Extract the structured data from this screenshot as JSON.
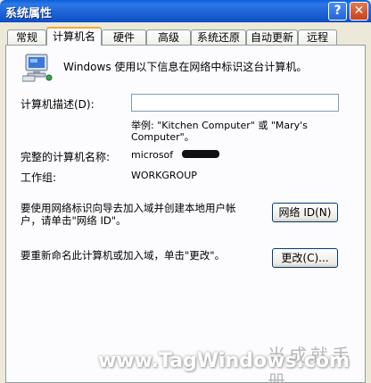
{
  "window": {
    "title": "系统属性",
    "help_label": "?",
    "close_label": "✕"
  },
  "tabs": [
    {
      "label": "常规"
    },
    {
      "label": "计算机名"
    },
    {
      "label": "硬件"
    },
    {
      "label": "高级"
    },
    {
      "label": "系统还原"
    },
    {
      "label": "自动更新"
    },
    {
      "label": "远程"
    }
  ],
  "panel": {
    "intro": "Windows 使用以下信息在网络中标识这台计算机。",
    "description_label": "计算机描述(D):",
    "description_value": "",
    "example_line1": "举例: \"Kitchen Computer\" 或 \"Mary's",
    "example_line2": "Computer\"。",
    "fullname_label": "完整的计算机名称:",
    "fullname_value": "microsof",
    "workgroup_label": "工作组:",
    "workgroup_value": "WORKGROUP",
    "network_text_line1": "要使用网络标识向导去加入域并创建本地用户帐",
    "network_text_line2": "户，请单击\"网络 ID\"。",
    "network_button": "网络 ID(N)",
    "rename_text": "要重新命名此计算机或加入域，单击\"更改\"。",
    "rename_button": "更改(C)..."
  },
  "watermark": {
    "text": "www.TagWindows.com",
    "brush": "当成就手册"
  },
  "colors": {
    "titlebar": "#0d4fc4",
    "face": "#ece9d8",
    "tab_accent": "#f2a93c"
  }
}
